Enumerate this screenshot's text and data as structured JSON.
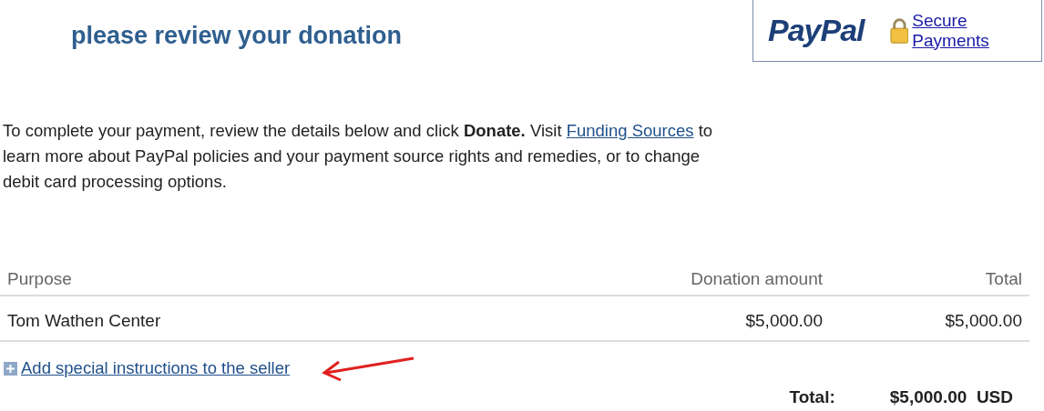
{
  "header": {
    "title": "please review your donation",
    "brand": "PayPal",
    "secure_link": "Secure Payments"
  },
  "intro": {
    "before": "To complete your payment, review the details below and click **Donate.** Visit",
    "link": "Funding Sources",
    "after": "to learn more about PayPal policies and your payment source rights and remedies, or to change debit card processing options."
  },
  "table": {
    "columns": [
      "Purpose",
      "Donation amount",
      "Total"
    ],
    "rows": [
      [
        "Tom Wathen Center",
        "$5,000.00",
        "$5,000.00"
      ]
    ]
  },
  "instructions_link": "Add special instructions to the seller",
  "total": {
    "label": "Total:",
    "amount": "$5,000.00",
    "currency": "USD"
  }
}
